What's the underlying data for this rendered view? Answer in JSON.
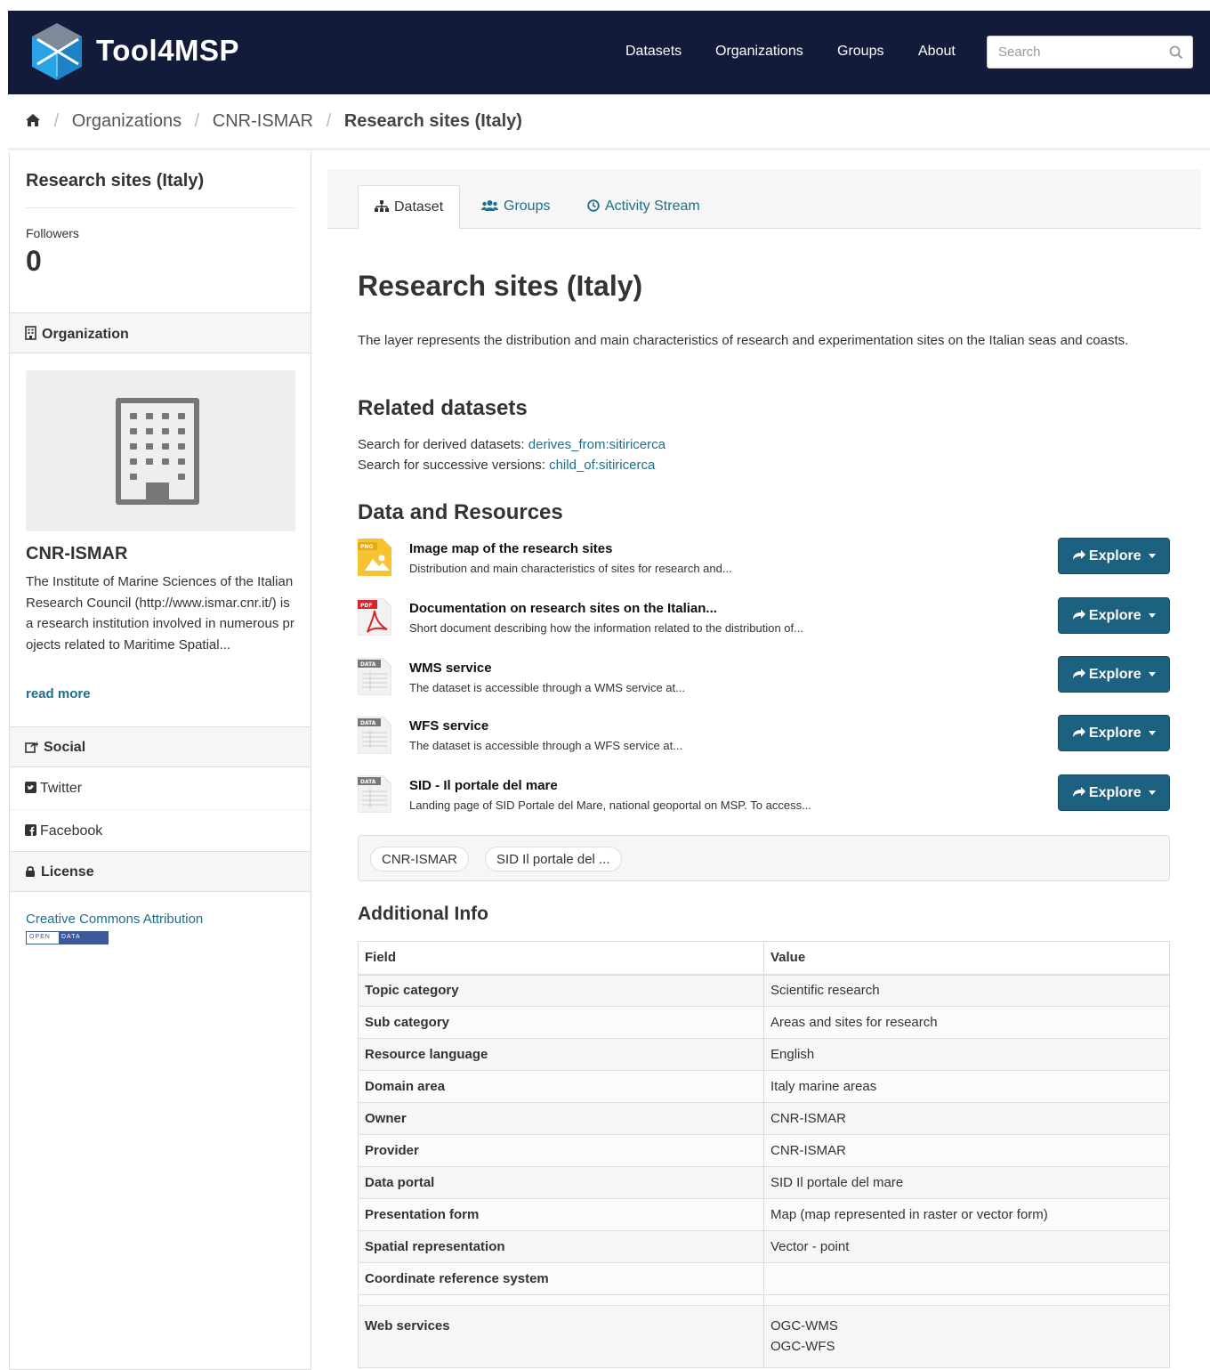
{
  "header": {
    "brand": "Tool4MSP",
    "nav": [
      "Datasets",
      "Organizations",
      "Groups",
      "About"
    ],
    "search_placeholder": "Search"
  },
  "breadcrumb": {
    "home_icon": "home-icon",
    "items": [
      "Organizations",
      "CNR-ISMAR",
      "Research sites (Italy)"
    ]
  },
  "sidebar": {
    "title": "Research sites (Italy)",
    "followers_label": "Followers",
    "followers_count": "0",
    "organization_header": "Organization",
    "org_name": "CNR-ISMAR",
    "org_description": "The Institute of Marine Sciences of the Italian Research Council (http://www.ismar.cnr.it/) is a research institution involved in numerous projects related to Maritime Spatial...",
    "read_more": "read more",
    "social_header": "Social",
    "social_links": [
      "Twitter",
      "Facebook"
    ],
    "license_header": "License",
    "license_link": "Creative Commons Attribution",
    "badge": {
      "open": "OPEN",
      "data": "DATA"
    }
  },
  "tabs": [
    {
      "label": "Dataset",
      "icon": "sitemap-icon"
    },
    {
      "label": "Groups",
      "icon": "users-icon"
    },
    {
      "label": "Activity Stream",
      "icon": "clock-icon"
    }
  ],
  "main": {
    "title": "Research sites (Italy)",
    "notes": "The layer represents the distribution and main characteristics of research and experimentation sites on the Italian seas and coasts.",
    "related_heading": "Related datasets",
    "derived_label": "Search for derived datasets:",
    "derived_link": "derives_from:sitiricerca",
    "successive_label": "Search for successive versions:",
    "successive_link": "child_of:sitiricerca",
    "resources_heading": "Data and Resources",
    "explore_label": "Explore",
    "resources": [
      {
        "format": "PNG",
        "title": "Image map of the research sites",
        "desc": "Distribution and main characteristics of sites for research and..."
      },
      {
        "format": "PDF",
        "title": "Documentation on research sites on the Italian...",
        "desc": "Short document describing how the information related to the distribution of..."
      },
      {
        "format": "DATA",
        "title": "WMS service",
        "desc": "The dataset is accessible through a WMS service at..."
      },
      {
        "format": "DATA",
        "title": "WFS service",
        "desc": "The dataset is accessible through a WFS service at..."
      },
      {
        "format": "DATA",
        "title": "SID - Il portale del mare",
        "desc": "Landing page of SID Portale del Mare, national geoportal on MSP. To access..."
      }
    ],
    "tags": [
      "CNR-ISMAR",
      "SID Il portale del ..."
    ],
    "additional_heading": "Additional Info",
    "table_headers": [
      "Field",
      "Value"
    ],
    "table_rows": [
      [
        "Topic category",
        "Scientific research"
      ],
      [
        "Sub category",
        "Areas and sites for research"
      ],
      [
        "Resource language",
        "English"
      ],
      [
        "Domain area",
        "Italy marine areas"
      ],
      [
        "Owner",
        "CNR-ISMAR"
      ],
      [
        "Provider",
        "CNR-ISMAR"
      ],
      [
        "Data portal",
        "SID Il portale del mare"
      ],
      [
        "Presentation form",
        "Map (map represented in raster or vector form)"
      ],
      [
        "Spatial representation",
        "Vector - point"
      ],
      [
        "Coordinate reference system",
        ""
      ]
    ],
    "web_services_label": "Web services",
    "web_services": [
      "OGC-WMS",
      "OGC-WFS"
    ]
  },
  "colors": {
    "header_bg": "#131b3a",
    "link": "#1d6f8c",
    "button": "#1d6180"
  }
}
